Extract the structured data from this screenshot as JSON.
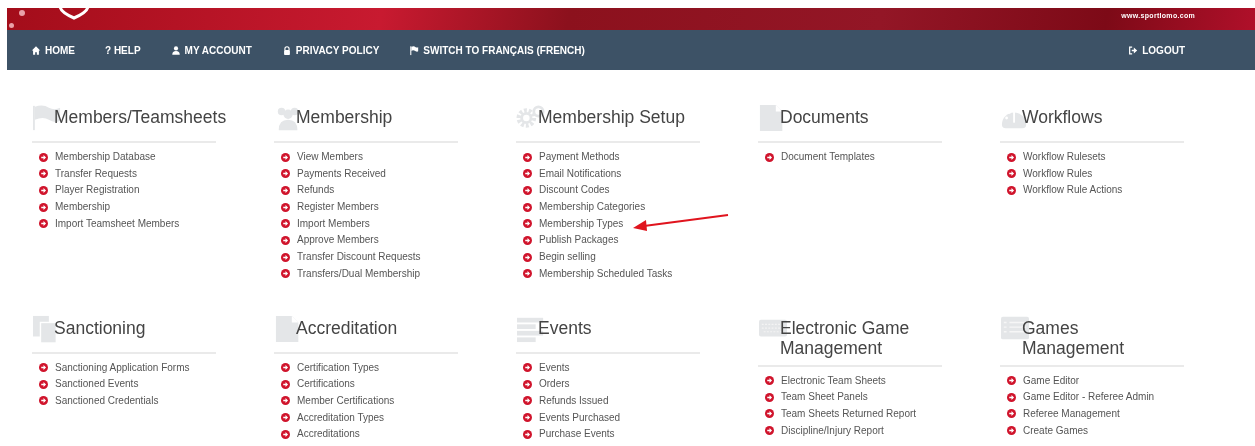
{
  "header": {
    "site": "www.sportlomo.com"
  },
  "nav": {
    "items": [
      {
        "label": "HOME"
      },
      {
        "label": "? HELP"
      },
      {
        "label": "MY ACCOUNT"
      },
      {
        "label": "PRIVACY POLICY"
      },
      {
        "label": "SWITCH TO FRANÇAIS (FRENCH)"
      }
    ],
    "logout": "LOGOUT"
  },
  "sections": [
    {
      "title": "Members/Teamsheets",
      "links": [
        "Membership Database",
        "Transfer Requests",
        "Player Registration",
        "Membership",
        "Import Teamsheet Members"
      ]
    },
    {
      "title": "Membership",
      "links": [
        "View Members",
        "Payments Received",
        "Refunds",
        "Register Members",
        "Import Members",
        "Approve Members",
        "Transfer Discount Requests",
        "Transfers/Dual Membership"
      ]
    },
    {
      "title": "Membership Setup",
      "links": [
        "Payment Methods",
        "Email Notifications",
        "Discount Codes",
        "Membership Categories",
        "Membership Types",
        "Publish Packages",
        "Begin selling",
        "Membership Scheduled Tasks"
      ]
    },
    {
      "title": "Documents",
      "links": [
        "Document Templates"
      ]
    },
    {
      "title": "Workflows",
      "links": [
        "Workflow Rulesets",
        "Workflow Rules",
        "Workflow Rule Actions"
      ]
    },
    {
      "title": "Sanctioning",
      "links": [
        "Sanctioning Application Forms",
        "Sanctioned Events",
        "Sanctioned Credentials"
      ]
    },
    {
      "title": "Accreditation",
      "links": [
        "Certification Types",
        "Certifications",
        "Member Certifications",
        "Accreditation Types",
        "Accreditations"
      ]
    },
    {
      "title": "Events",
      "links": [
        "Events",
        "Orders",
        "Refunds Issued",
        "Events Purchased",
        "Purchase Events"
      ]
    },
    {
      "title": "Electronic Game Management",
      "links": [
        "Electronic Team Sheets",
        "Team Sheet Panels",
        "Team Sheets Returned Report",
        "Discipline/Injury Report"
      ]
    },
    {
      "title": "Games Management",
      "links": [
        "Game Editor",
        "Game Editor - Referee Admin",
        "Referee Management",
        "Create Games"
      ]
    }
  ]
}
